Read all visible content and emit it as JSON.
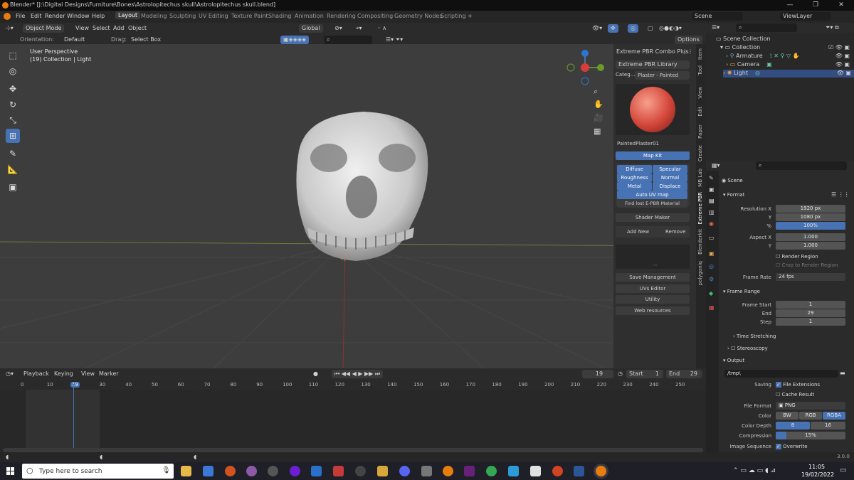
{
  "window": {
    "title": "Blender* [J:\\Digital Designs\\Furniture\\Bones\\Astrolopitechus skull\\Astrolopitechus skull.blend]",
    "minimize": "—",
    "maximize": "❐",
    "close": "✕"
  },
  "menu": [
    "File",
    "Edit",
    "Render",
    "Window",
    "Help"
  ],
  "workspaces": [
    "Layout",
    "Modeling",
    "Sculpting",
    "UV Editing",
    "Texture Paint",
    "Shading",
    "Animation",
    "Rendering",
    "Compositing",
    "Geometry Nodes",
    "Scripting"
  ],
  "scene_field": "Scene",
  "viewlayer_field": "ViewLayer",
  "vp_header": {
    "mode": "Object Mode",
    "view": "View",
    "select": "Select",
    "add": "Add",
    "object": "Object",
    "transform": "Global",
    "orientation_label": "Orientation:",
    "orientation_value": "Default",
    "drag_label": "Drag:",
    "drag_value": "Select Box",
    "options": "Options"
  },
  "viewport": {
    "perspective": "User Perspective",
    "collection_info": "(19) Collection | Light"
  },
  "npanel": {
    "title": "Extreme PBR Combo Plus",
    "library": "Extreme PBR Library",
    "category_label": "Categ...",
    "category_value": "Plaster - Painted",
    "material_name": "PaintedPlaster01",
    "map_kit": "Map Kit",
    "maps": [
      "Diffuse",
      "Specular",
      "Roughness",
      "Normal",
      "Metal",
      "Displace"
    ],
    "auto_uv": "Auto UV map",
    "find_lost": "Find lost E-PBR Material",
    "shader_maker": "Shader Maker",
    "add_new": "Add New",
    "remove": "Remove",
    "list_marker": "::::",
    "sections": [
      "Save Management",
      "UVs Editor",
      "Utility",
      "Web resources"
    ]
  },
  "ntabs": [
    "Item",
    "Tool",
    "View",
    "Edit",
    "Paper",
    "Create",
    "MB Lab",
    "Extreme PBR",
    "Blenderkit",
    "polygoniq"
  ],
  "timeline": {
    "menus": [
      "Playback",
      "Keying",
      "View",
      "Marker"
    ],
    "current_frame": "19",
    "start_label": "Start",
    "start": "1",
    "end_label": "End",
    "end": "29",
    "ticks": [
      "0",
      "10",
      "19",
      "30",
      "40",
      "50",
      "60",
      "70",
      "80",
      "90",
      "100",
      "110",
      "120",
      "130",
      "140",
      "150",
      "160",
      "170",
      "180",
      "190",
      "200",
      "210",
      "220",
      "230",
      "240",
      "250"
    ]
  },
  "outliner": {
    "root": "Scene Collection",
    "collection": "Collection",
    "items": [
      "Armature",
      "Camera",
      "Light"
    ],
    "selected": "Light"
  },
  "properties": {
    "scene": "Scene",
    "format": "Format",
    "res_x_label": "Resolution X",
    "res_x": "1920 px",
    "res_y_label": "Y",
    "res_y": "1080 px",
    "pct_label": "%",
    "pct": "100%",
    "aspect_x_label": "Aspect X",
    "aspect_x": "1.000",
    "aspect_y_label": "Y",
    "aspect_y": "1.000",
    "render_region": "Render Region",
    "crop_region": "Crop to Render Region",
    "frame_rate_label": "Frame Rate",
    "frame_rate": "24 fps",
    "frame_range": "Frame Range",
    "frame_start_label": "Frame Start",
    "frame_start": "1",
    "end_label": "End",
    "end": "29",
    "step_label": "Step",
    "step": "1",
    "time_stretching": "Time Stretching",
    "stereoscopy": "Stereoscopy",
    "output": "Output",
    "path": "/tmp\\",
    "saving_label": "Saving",
    "file_ext": "File Extensions",
    "cache": "Cache Result",
    "file_format_label": "File Format",
    "file_format": "PNG",
    "color_label": "Color",
    "color_opts": [
      "BW",
      "RGB",
      "RGBA"
    ],
    "depth_label": "Color Depth",
    "depth_opts": [
      "8",
      "16"
    ],
    "compression_label": "Compression",
    "compression": "15%",
    "compression_value": 0.15,
    "seq_label": "Image Sequence",
    "overwrite": "Overwrite"
  },
  "status": {
    "version": "3.0.0"
  },
  "taskbar": {
    "search": "Type here to search",
    "time": "11:05",
    "date": "19/02/2022"
  },
  "colors": {
    "accent": "#4772b3",
    "blender_orange": "#e87d0d"
  }
}
